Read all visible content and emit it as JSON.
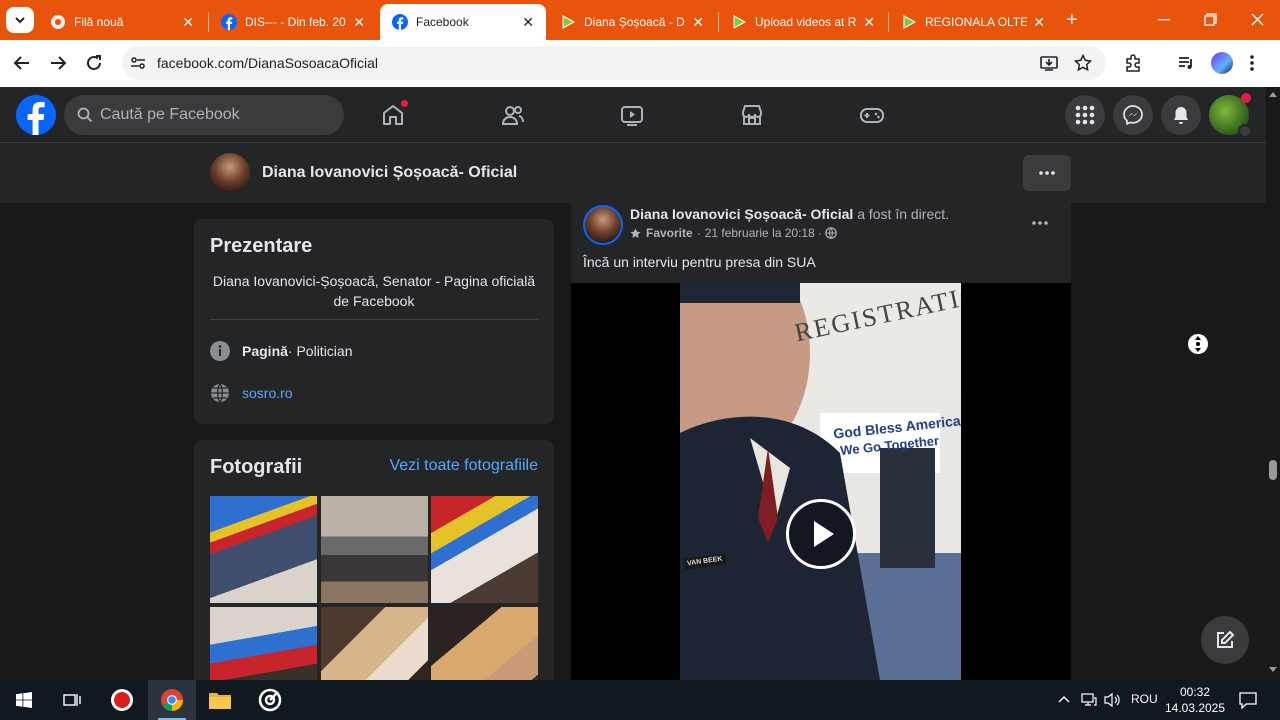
{
  "browser": {
    "tabs": [
      {
        "title": "Filă nouă",
        "icon": "chrome-icon",
        "active": false
      },
      {
        "title": "DIS--- - Din feb. 20",
        "icon": "facebook-icon",
        "active": false
      },
      {
        "title": "Facebook",
        "icon": "facebook-icon",
        "active": true
      },
      {
        "title": "Diana Șoșoacă - D",
        "icon": "rumble-icon",
        "active": false
      },
      {
        "title": "Upload videos at R",
        "icon": "rumble-icon",
        "active": false
      },
      {
        "title": "REGIONALA OLTEN",
        "icon": "rumble-icon",
        "active": false
      }
    ],
    "close_glyph": "✕",
    "new_tab_glyph": "+",
    "url": "facebook.com/DianaSosoacaOficial",
    "accent_color": "#e8540c"
  },
  "facebook": {
    "search_placeholder": "Caută pe Facebook",
    "page_name": "Diana Iovanovici Șoșoacă- Oficial",
    "more_glyph": "···",
    "intro": {
      "title": "Prezentare",
      "description": "Diana Iovanovici-Șoșoacă, Senator - Pagina oficială de Facebook",
      "category_bold": "Pagină",
      "category_rest": " · Politician",
      "website": "sosro.ro"
    },
    "photos": {
      "title": "Fotografii",
      "see_all": "Vezi toate fotografiile"
    },
    "post": {
      "author": "Diana Iovanovici Șoșoacă- Oficial",
      "action": " a fost în direct.",
      "favorites": "Favorite",
      "date": "21 februarie la 20:18",
      "separator": "·",
      "text": "Încă un interviu pentru presa din SUA",
      "video_sign_text": "REGISTRATION",
      "video_banner_line1": "God Bless America",
      "video_banner_line2": "We Go Together",
      "video_nametag": "VAN BEEK"
    }
  },
  "taskbar": {
    "language": "ROU",
    "time": "00:32",
    "date": "14.03.2025"
  }
}
